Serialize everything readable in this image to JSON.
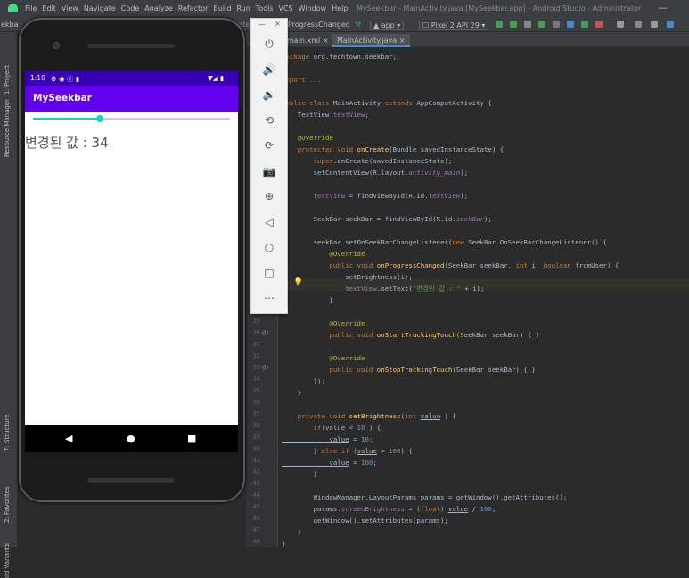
{
  "menu": [
    "File",
    "Edit",
    "View",
    "Navigate",
    "Code",
    "Analyze",
    "Refactor",
    "Build",
    "Run",
    "Tools",
    "VCS",
    "Window",
    "Help"
  ],
  "window_title": "MySeekbar - MainActivity.java [MySeekbar.app] - Android Studio - Administrator",
  "window_controls": "—",
  "toolbar": {
    "run_config": "app",
    "device": "Pixel 2 API 29",
    "listener_crumb": "ProgressChanged",
    "crumb_prefix": "iste",
    "left_crumb": "ekba"
  },
  "sidebar": [
    "1: Project",
    "Resource Manager",
    "7: Structure",
    "2: Favorites",
    "ild Variants"
  ],
  "tabs": [
    {
      "label": "main.xml"
    },
    {
      "label": "MainActivity.java"
    }
  ],
  "gutter": [
    {
      "n": "",
      "mark": ""
    },
    {
      "n": "",
      "mark": ""
    },
    {
      "n": "",
      "mark": ""
    },
    {
      "n": "",
      "mark": ""
    },
    {
      "n": "",
      "mark": ""
    },
    {
      "n": "",
      "mark": ""
    },
    {
      "n": "",
      "mark": ""
    },
    {
      "n": "",
      "mark": ""
    },
    {
      "n": "",
      "mark": ""
    },
    {
      "n": "",
      "mark": ""
    },
    {
      "n": "",
      "mark": ""
    },
    {
      "n": "",
      "mark": ""
    },
    {
      "n": "",
      "mark": ""
    },
    {
      "n": "",
      "mark": ""
    },
    {
      "n": "",
      "mark": ""
    },
    {
      "n": "",
      "mark": ""
    },
    {
      "n": "",
      "mark": ""
    },
    {
      "n": "",
      "mark": ""
    },
    {
      "n": "",
      "mark": ""
    },
    {
      "n": "",
      "mark": ""
    },
    {
      "n": "",
      "mark": ""
    },
    {
      "n": "",
      "mark": ""
    },
    {
      "n": "",
      "mark": ""
    },
    {
      "n": "29",
      "mark": ""
    },
    {
      "n": "30",
      "mark": "@↑"
    },
    {
      "n": "31",
      "mark": ""
    },
    {
      "n": "32",
      "mark": ""
    },
    {
      "n": "33",
      "mark": "@↑"
    },
    {
      "n": "34",
      "mark": ""
    },
    {
      "n": "35",
      "mark": ""
    },
    {
      "n": "36",
      "mark": ""
    },
    {
      "n": "37",
      "mark": ""
    },
    {
      "n": "38",
      "mark": ""
    },
    {
      "n": "39",
      "mark": ""
    },
    {
      "n": "40",
      "mark": ""
    },
    {
      "n": "41",
      "mark": ""
    },
    {
      "n": "42",
      "mark": ""
    },
    {
      "n": "43",
      "mark": ""
    },
    {
      "n": "44",
      "mark": ""
    },
    {
      "n": "45",
      "mark": ""
    },
    {
      "n": "46",
      "mark": ""
    },
    {
      "n": "47",
      "mark": ""
    },
    {
      "n": "48",
      "mark": ""
    }
  ],
  "code": [
    [
      [
        "kw",
        "package "
      ],
      [
        "",
        "org.techtown.seekbar;"
      ]
    ],
    [
      [
        "",
        ""
      ]
    ],
    [
      [
        "kw",
        "import "
      ],
      [
        "gr",
        "..."
      ]
    ],
    [
      [
        "",
        ""
      ]
    ],
    [
      [
        "kw",
        "public class "
      ],
      [
        "",
        "MainActivity "
      ],
      [
        "kw",
        "extends "
      ],
      [
        "",
        "AppCompatActivity {"
      ]
    ],
    [
      [
        "",
        "    TextView "
      ],
      [
        "fd",
        "textView"
      ],
      [
        "",
        ";"
      ]
    ],
    [
      [
        "",
        ""
      ]
    ],
    [
      [
        "an",
        "    @Override"
      ]
    ],
    [
      [
        "kw",
        "    protected void "
      ],
      [
        "fn",
        "onCreate"
      ],
      [
        "",
        "(Bundle savedInstanceState) {"
      ]
    ],
    [
      [
        "kw",
        "        super"
      ],
      [
        "",
        ".onCreate(savedInstanceState);"
      ]
    ],
    [
      [
        "",
        "        setContentView(R.layout."
      ],
      [
        "it",
        "activity_main"
      ],
      [
        "",
        ");"
      ]
    ],
    [
      [
        "",
        ""
      ]
    ],
    [
      [
        "fd",
        "        textView"
      ],
      [
        "",
        " = findViewById(R.id."
      ],
      [
        "it",
        "textView"
      ],
      [
        "",
        ");"
      ]
    ],
    [
      [
        "",
        ""
      ]
    ],
    [
      [
        "",
        "        SeekBar seekBar = findViewById(R.id."
      ],
      [
        "it",
        "seekBar"
      ],
      [
        "",
        ");"
      ]
    ],
    [
      [
        "",
        ""
      ]
    ],
    [
      [
        "",
        "        seekBar.setOnSeekBarChangeListener("
      ],
      [
        "kw",
        "new "
      ],
      [
        "",
        "SeekBar.OnSeekBarChangeListener() {"
      ]
    ],
    [
      [
        "an",
        "            @Override"
      ]
    ],
    [
      [
        "kw",
        "            public void "
      ],
      [
        "fn",
        "onProgressChanged"
      ],
      [
        "",
        "(SeekBar seekBar, "
      ],
      [
        "kw",
        "int "
      ],
      [
        "",
        "i, "
      ],
      [
        "kw",
        "boolean "
      ],
      [
        "",
        "fromUser) {"
      ]
    ],
    [
      [
        "",
        "                setBrightness(i);"
      ]
    ],
    [
      [
        "fd",
        "                textView"
      ],
      [
        "",
        ".setText("
      ],
      [
        "st",
        "\"변경된 값 : \""
      ],
      [
        "",
        " + i);"
      ]
    ],
    [
      [
        "",
        "            }"
      ]
    ],
    [
      [
        "",
        ""
      ]
    ],
    [
      [
        "an",
        "            @Override"
      ]
    ],
    [
      [
        "kw",
        "            public void "
      ],
      [
        "fn",
        "onStartTrackingTouch"
      ],
      [
        "",
        "(SeekBar seekBar) { }"
      ]
    ],
    [
      [
        "",
        ""
      ]
    ],
    [
      [
        "an",
        "            @Override"
      ]
    ],
    [
      [
        "kw",
        "            public void "
      ],
      [
        "fn",
        "onStopTrackingTouch"
      ],
      [
        "",
        "(SeekBar seekBar) { }"
      ]
    ],
    [
      [
        "",
        "        });"
      ]
    ],
    [
      [
        "",
        "    }"
      ]
    ],
    [
      [
        "",
        ""
      ]
    ],
    [
      [
        "kw",
        "    private void "
      ],
      [
        "fn",
        "setBrightness"
      ],
      [
        "",
        "("
      ],
      [
        "kw",
        "int "
      ],
      [
        "ul",
        "value"
      ],
      [
        "",
        " ) {"
      ]
    ],
    [
      [
        "kw",
        "        if"
      ],
      [
        "",
        "(value < "
      ],
      [
        "nm",
        "10"
      ],
      [
        "",
        " ) {"
      ]
    ],
    [
      [
        "ul",
        "            value"
      ],
      [
        "",
        " = "
      ],
      [
        "nm",
        "10"
      ],
      [
        "",
        ";"
      ]
    ],
    [
      [
        "",
        "        } "
      ],
      [
        "kw",
        "else if "
      ],
      [
        "",
        "("
      ],
      [
        "ul",
        "value"
      ],
      [
        "",
        " > "
      ],
      [
        "nm",
        "100"
      ],
      [
        "",
        ") {"
      ]
    ],
    [
      [
        "ul",
        "            value"
      ],
      [
        "",
        " = "
      ],
      [
        "nm",
        "100"
      ],
      [
        "",
        ";"
      ]
    ],
    [
      [
        "",
        "        }"
      ]
    ],
    [
      [
        "",
        ""
      ]
    ],
    [
      [
        "",
        "        WindowManager.LayoutParams params = getWindow().getAttributes();"
      ]
    ],
    [
      [
        "",
        "        params."
      ],
      [
        "fd",
        "screenBrightness"
      ],
      [
        "",
        " = ("
      ],
      [
        "kw",
        "float"
      ],
      [
        "",
        ") "
      ],
      [
        "ul",
        "value"
      ],
      [
        "",
        " / "
      ],
      [
        "nm",
        "100"
      ],
      [
        "",
        ";"
      ]
    ],
    [
      [
        "",
        "        getWindow().setAttributes(params);"
      ]
    ],
    [
      [
        "",
        "    }"
      ]
    ],
    [
      [
        "",
        "}"
      ]
    ]
  ],
  "emulator_panel": {
    "min": "—",
    "close": "×",
    "buttons": [
      {
        "name": "power-icon",
        "glyph": "⏻"
      },
      {
        "name": "volume-up-icon",
        "glyph": "🔊"
      },
      {
        "name": "volume-down-icon",
        "glyph": "🔉"
      },
      {
        "name": "rotate-left-icon",
        "glyph": "⟲"
      },
      {
        "name": "rotate-right-icon",
        "glyph": "⟳"
      },
      {
        "name": "camera-icon",
        "glyph": "📷"
      },
      {
        "name": "zoom-icon",
        "glyph": "⊕"
      },
      {
        "name": "back-icon",
        "glyph": "◁"
      },
      {
        "name": "home-icon",
        "glyph": "○"
      },
      {
        "name": "overview-icon",
        "glyph": "□"
      },
      {
        "name": "more-icon",
        "glyph": "⋯"
      }
    ]
  },
  "phone": {
    "status_time": "1:10",
    "status_icons": "⚙ ◉ ⓟ ▮",
    "status_right": "▼◢ ▮",
    "app_title": "MySeekbar",
    "seek_progress": 0.34,
    "value_text": "변경된 값 : 34",
    "nav": [
      "◀",
      "●",
      "■"
    ]
  },
  "colors": {
    "accent": "#03dac5",
    "primary": "#6200ee",
    "primary_dark": "#3700b3"
  }
}
